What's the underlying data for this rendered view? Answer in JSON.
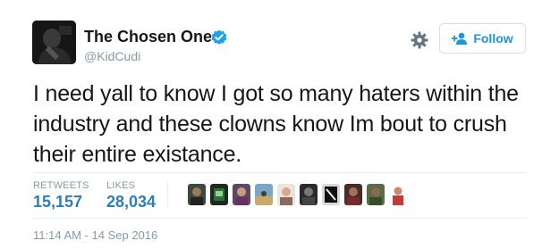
{
  "author": {
    "name": "The Chosen One",
    "handle": "@KidCudi",
    "verified": true
  },
  "follow_button": {
    "label": "Follow",
    "icon": "add-user-icon"
  },
  "settings_icon": "gear-icon",
  "tweet": {
    "text": "I need yall to know I got so many haters within the industry and these clowns know Im bout to crush their entire existance."
  },
  "stats": {
    "retweets_label": "RETWEETS",
    "retweets_count": "15,157",
    "likes_label": "LIKES",
    "likes_count": "28,034"
  },
  "likers": [
    {
      "icon": "user-avatar"
    },
    {
      "icon": "user-avatar"
    },
    {
      "icon": "user-avatar"
    },
    {
      "icon": "user-avatar"
    },
    {
      "icon": "user-avatar"
    },
    {
      "icon": "user-avatar"
    },
    {
      "icon": "user-avatar"
    },
    {
      "icon": "user-avatar"
    },
    {
      "icon": "user-avatar"
    },
    {
      "icon": "user-avatar"
    }
  ],
  "timestamp": "11:14 AM - 14 Sep 2016",
  "colors": {
    "accent": "#1b95e0",
    "count": "#2f7eb8",
    "muted": "#8899a6",
    "text": "#14171a"
  }
}
